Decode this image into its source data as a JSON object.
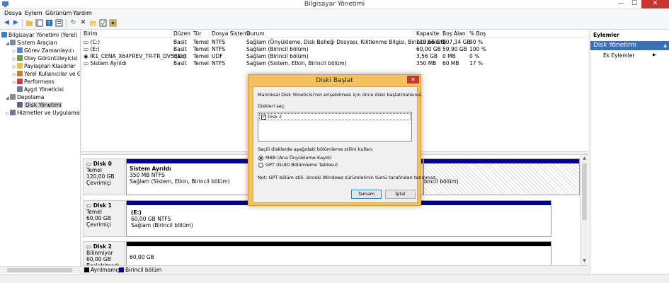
{
  "window": {
    "title": "Bilgisayar Yönetimi",
    "minimize": "—",
    "maximize": "☐",
    "close": "✕"
  },
  "menu": [
    "Dosya",
    "Eylem",
    "Görünüm",
    "Yardım"
  ],
  "tree": {
    "root": "Bilgisayar Yönetimi (Yerel)",
    "system_tools": "Sistem Araçları",
    "task_scheduler": "Görev Zamanlayıcı",
    "event_viewer": "Olay Görüntüleyicisi",
    "shared_folders": "Paylaşılan Klasörler",
    "local_users": "Yerel Kullanıcılar ve Gru",
    "performance": "Performans",
    "device_manager": "Aygıt Yöneticisi",
    "storage": "Depolama",
    "disk_management": "Disk Yönetimi",
    "services": "Hizmetler ve Uygulamalar"
  },
  "volumes": {
    "headers": [
      "Birim",
      "Düzen",
      "Tür",
      "Dosya Sistemi",
      "Durum",
      "Kapasite",
      "Boş Alan",
      "% Boş"
    ],
    "rows": [
      [
        "(C:)",
        "Basit",
        "Temel",
        "NTFS",
        "Sağlam (Önyükleme, Disk Belleği Dosyası, Kilitlenme Bilgisi, Birincil bölüm)",
        "119,66 GB",
        "107,34 GB",
        "90 %"
      ],
      [
        "(E:)",
        "Basit",
        "Temel",
        "NTFS",
        "Sağlam (Birincil bölüm)",
        "60,00 GB",
        "59,90 GB",
        "100 %"
      ],
      [
        "IR1_CENA_X64FREV_TR-TR_DV5 (D:)",
        "Basit",
        "Temel",
        "UDF",
        "Sağlam (Birincil bölüm)",
        "3,56 GB",
        "0 MB",
        "0 %"
      ],
      [
        "Sistem Ayrıldı",
        "Basit",
        "Temel",
        "NTFS",
        "Sağlam (Sistem, Etkin, Birincil bölüm)",
        "350 MB",
        "60 MB",
        "17 %"
      ]
    ]
  },
  "disks": [
    {
      "name": "Disk 0",
      "type": "Temel",
      "size": "120,00 GB",
      "state": "Çevrimiçi",
      "part_title": "Sistem Ayrıldı",
      "part_line1": "350 MB NTFS",
      "part_line2": "Sağlam (Sistem, Etkin, Birincil bölüm)",
      "part2_line": "bincil bölüm)"
    },
    {
      "name": "Disk 1",
      "type": "Temel",
      "size": "60,00 GB",
      "state": "Çevrimiçi",
      "part_title": "(E:)",
      "part_line1": "60,00 GB NTFS",
      "part_line2": "Sağlam (Birincil bölüm)"
    },
    {
      "name": "Disk 2",
      "type": "Bilinmiyor",
      "size": "60,00 GB",
      "state": "Başlatılmadı",
      "part_line1": "60,00 GB"
    }
  ],
  "legend": {
    "unallocated": "Ayrılmamış",
    "primary": "Birincil bölüm",
    "colors": {
      "unallocated": "#000000",
      "primary": "#00008b"
    }
  },
  "actions": {
    "header": "Eylemler",
    "selected": "Disk Yönetimi",
    "more": "Ek Eylemler"
  },
  "dialog": {
    "title": "Diski Başlat",
    "close": "✕",
    "intro": "Mantıksal Disk Yöneticisi'nin erişebilmesi için önce diski başlatmalısınız.",
    "select_label": "Diskleri seç:",
    "disk_item": "Disk 2",
    "style_label": "Seçili disklerde aşağıdaki bölümleme stilini kullan:",
    "mbr": "MBR (Ana Önyükleme Kaydı)",
    "gpt": "GPT (GUID Bölümleme Tablosu)",
    "note": "Not: GPT bölüm stili, önceki Windows sürümlerinin tümü tarafından tanınmaz.",
    "ok": "Tamam",
    "cancel": "İptal"
  },
  "colors": {
    "accent": "#3b6fb6",
    "dialog_frame": "#f4c15f",
    "close_red": "#c7372f"
  }
}
